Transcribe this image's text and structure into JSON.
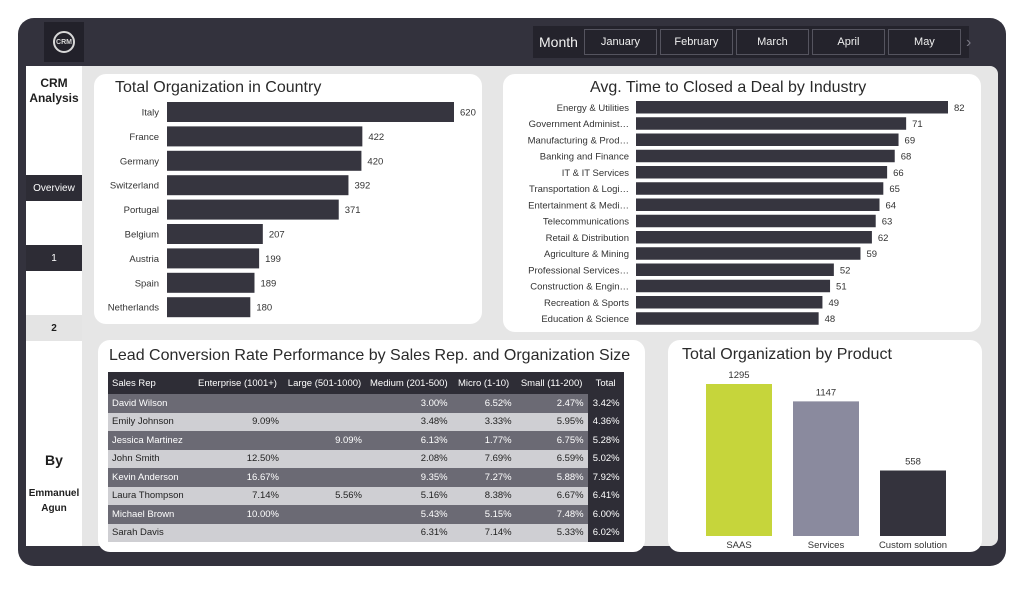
{
  "header": {
    "logo_text": "CRM",
    "month_label": "Month",
    "months": [
      "January",
      "February",
      "March",
      "April",
      "May"
    ]
  },
  "sidebar": {
    "title_line1": "CRM",
    "title_line2": "Analysis",
    "nav": [
      "Overview",
      "1",
      "2"
    ],
    "by": "By",
    "author_line1": "Emmanuel",
    "author_line2": "Agun"
  },
  "colors": {
    "bar_dark": "#36353f",
    "saas": "#c6d53b",
    "services": "#8a8a9e",
    "custom": "#34333d"
  },
  "chart_data": [
    {
      "type": "bar",
      "orientation": "horizontal",
      "title": "Total Organization in Country",
      "categories": [
        "Italy",
        "France",
        "Germany",
        "Switzerland",
        "Portugal",
        "Belgium",
        "Austria",
        "Spain",
        "Netherlands"
      ],
      "values": [
        620,
        422,
        420,
        392,
        371,
        207,
        199,
        189,
        180
      ]
    },
    {
      "type": "bar",
      "orientation": "horizontal",
      "title": "Avg. Time to Closed a Deal by Industry",
      "categories": [
        "Energy & Utilities",
        "Government Administ…",
        "Manufacturing & Prod…",
        "Banking and Finance",
        "IT & IT Services",
        "Transportation & Logi…",
        "Entertainment & Medi…",
        "Telecommunications",
        "Retail & Distribution",
        "Agriculture & Mining",
        "Professional Services…",
        "Construction & Engin…",
        "Recreation & Sports",
        "Education & Science"
      ],
      "values": [
        82,
        71,
        69,
        68,
        66,
        65,
        64,
        63,
        62,
        59,
        52,
        51,
        49,
        48
      ]
    },
    {
      "type": "table",
      "title": "Lead Conversion Rate Performance by Sales Rep. and Organization Size",
      "columns": [
        "Sales Rep",
        "Enterprise (1001+)",
        "Large (501-1000)",
        "Medium (201-500)",
        "Micro (1-10)",
        "Small (11-200)",
        "Total"
      ],
      "rows": [
        [
          "David Wilson",
          "",
          "",
          "3.00%",
          "6.52%",
          "2.47%",
          "3.42%"
        ],
        [
          "Emily Johnson",
          "9.09%",
          "",
          "3.48%",
          "3.33%",
          "5.95%",
          "4.36%"
        ],
        [
          "Jessica Martinez",
          "",
          "9.09%",
          "6.13%",
          "1.77%",
          "6.75%",
          "5.28%"
        ],
        [
          "John Smith",
          "12.50%",
          "",
          "2.08%",
          "7.69%",
          "6.59%",
          "5.02%"
        ],
        [
          "Kevin Anderson",
          "16.67%",
          "",
          "9.35%",
          "7.27%",
          "5.88%",
          "7.92%"
        ],
        [
          "Laura Thompson",
          "7.14%",
          "5.56%",
          "5.16%",
          "8.38%",
          "6.67%",
          "6.41%"
        ],
        [
          "Michael Brown",
          "10.00%",
          "",
          "5.43%",
          "5.15%",
          "7.48%",
          "6.00%"
        ],
        [
          "Sarah Davis",
          "",
          "",
          "6.31%",
          "7.14%",
          "5.33%",
          "6.02%"
        ]
      ]
    },
    {
      "type": "bar",
      "orientation": "vertical",
      "title": "Total Organization by Product",
      "categories": [
        "SAAS",
        "Services",
        "Custom solution"
      ],
      "values": [
        1295,
        1147,
        558
      ]
    }
  ]
}
